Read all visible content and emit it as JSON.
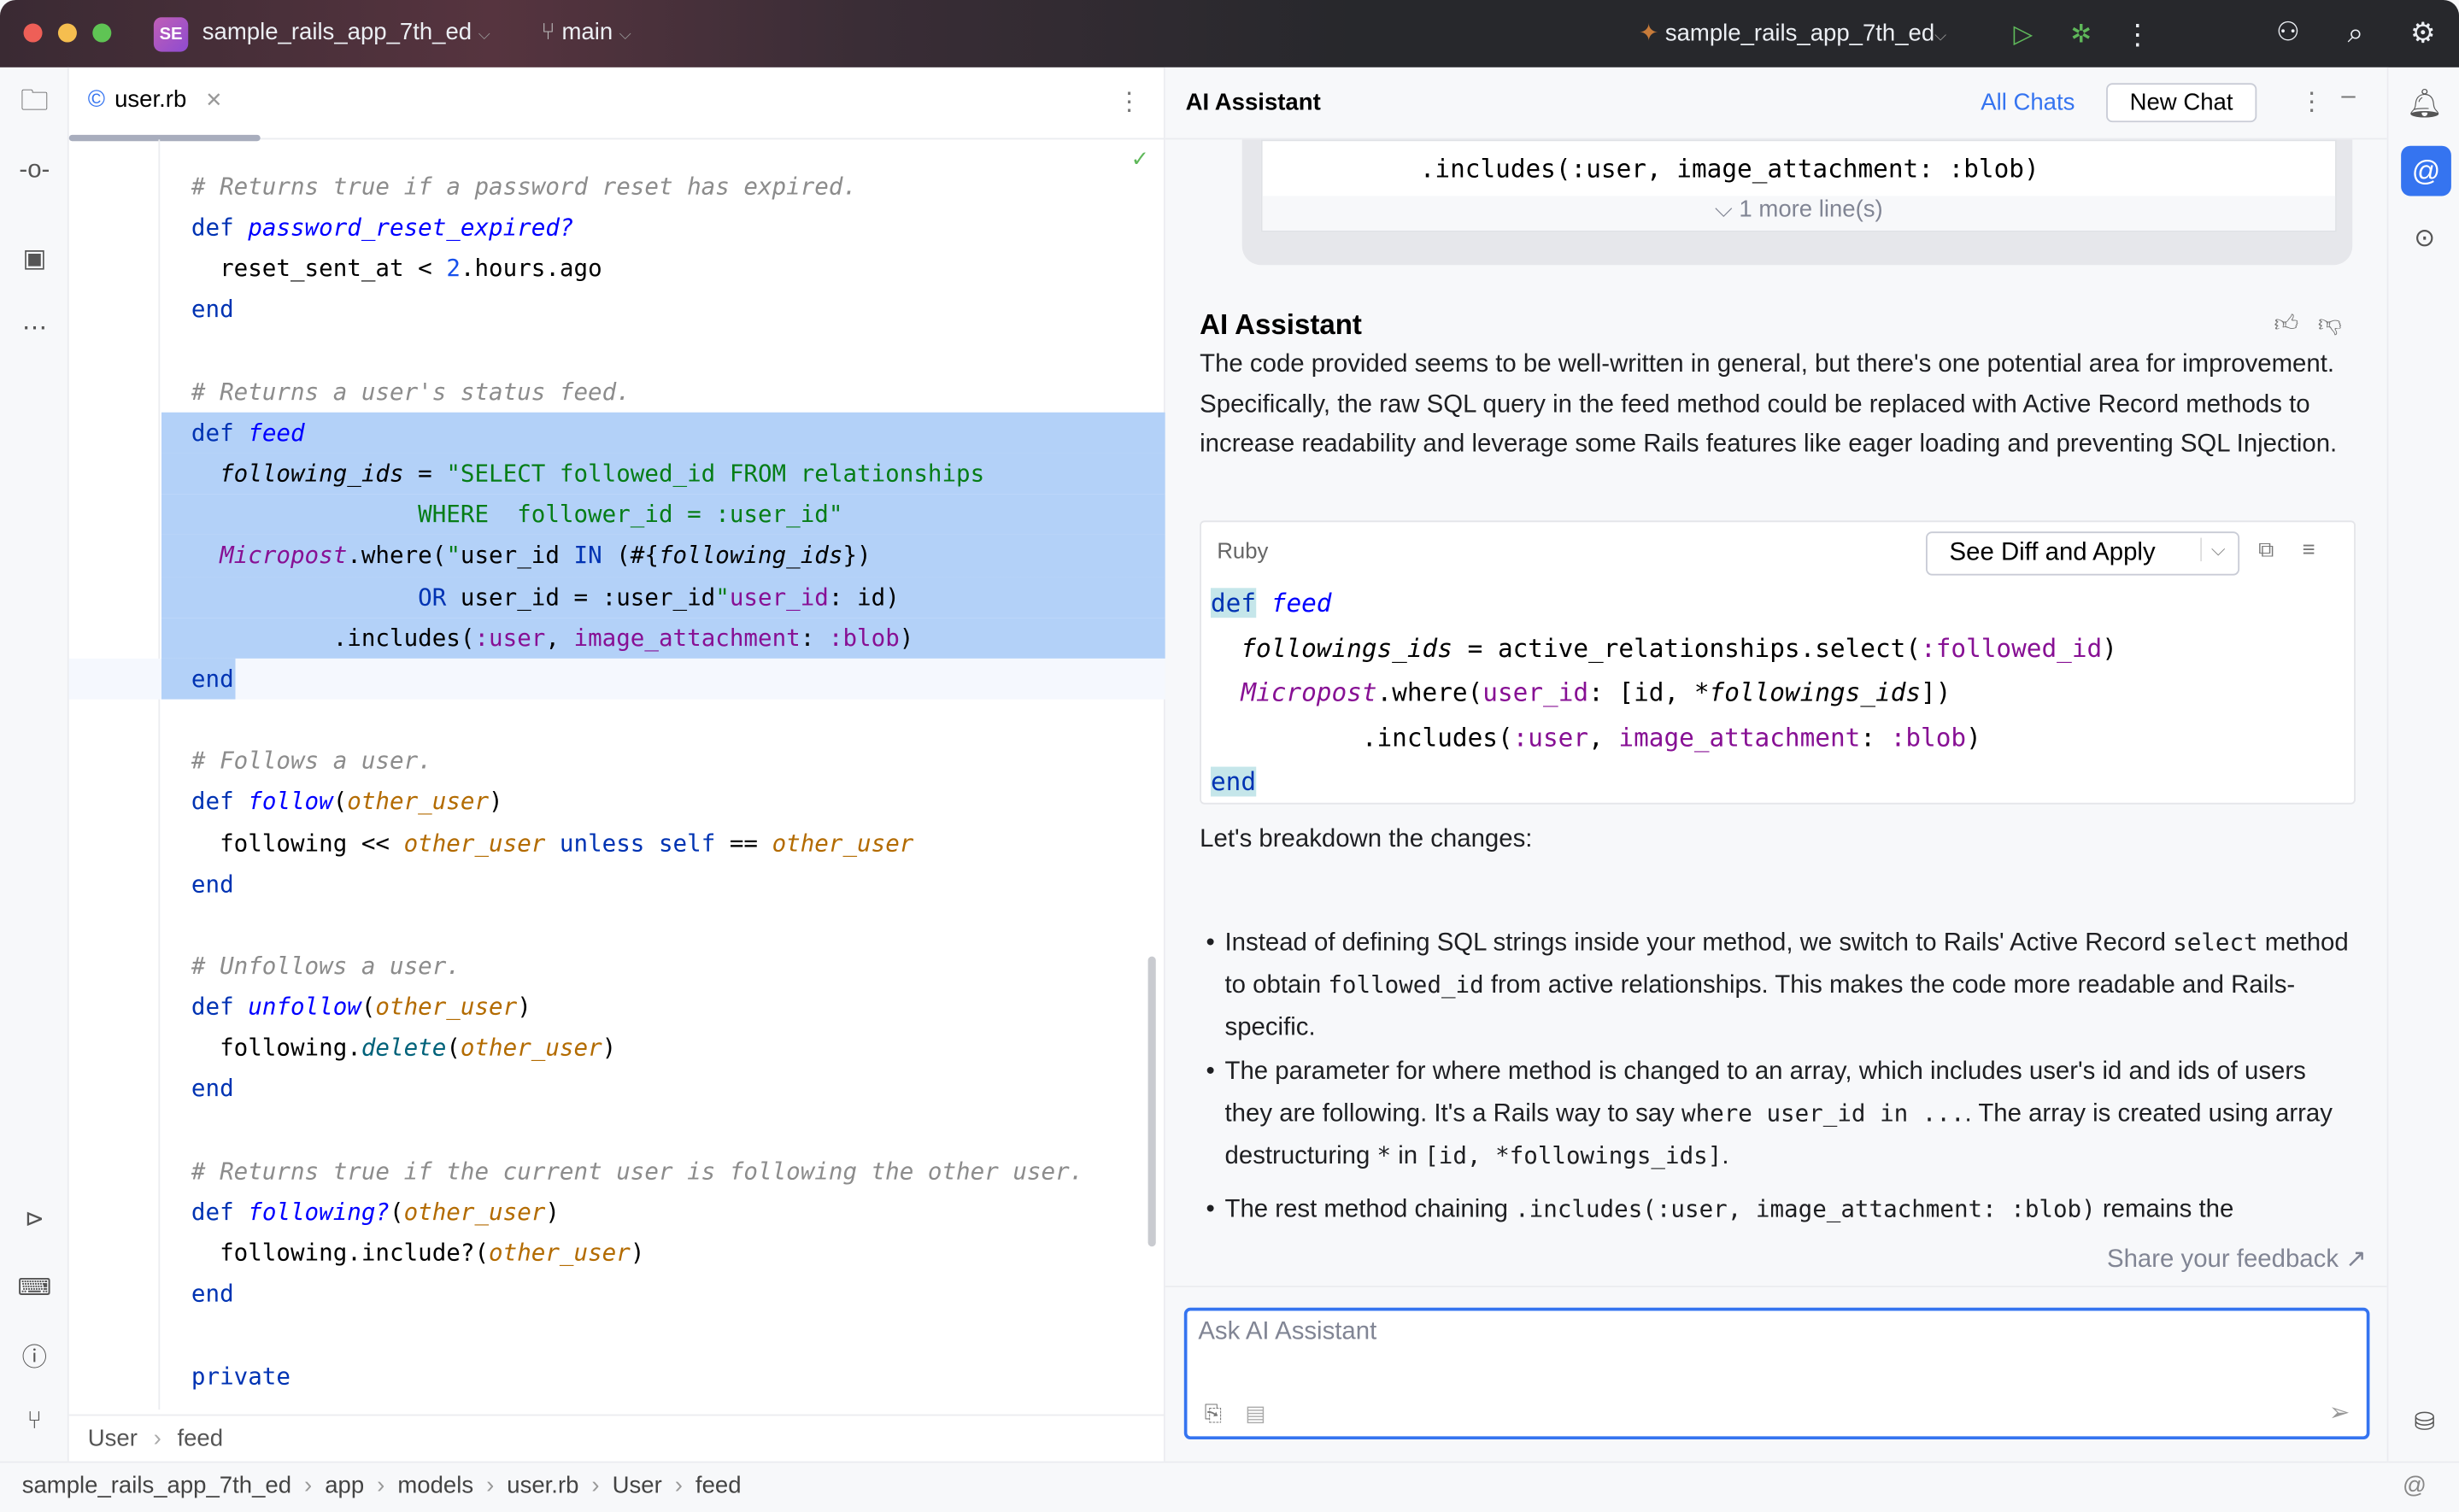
{
  "titlebar": {
    "project_badge": "SE",
    "project": "sample_rails_app_7th_ed",
    "branch": "main",
    "run_config": "sample_rails_app_7th_ed"
  },
  "editor": {
    "tab": "user.rb",
    "breadcrumb": [
      "User",
      "feed"
    ],
    "lines": [
      [
        [
          "c",
          "# Returns true "
        ],
        [
          "c",
          "if"
        ],
        [
          "c",
          " a password reset has expired."
        ]
      ],
      [
        [
          "k",
          "def "
        ],
        [
          "f",
          "password_reset_expired?"
        ]
      ],
      [
        [
          "",
          "  reset_sent_at < "
        ],
        [
          "n",
          "2"
        ],
        [
          "",
          ".hours.ago"
        ]
      ],
      [
        [
          "k",
          "end"
        ]
      ],
      [],
      [
        [
          "c",
          "# Returns a user's status feed."
        ]
      ],
      [
        [
          "k",
          "def "
        ],
        [
          "f",
          "feed"
        ]
      ],
      [
        [
          "",
          "  "
        ],
        [
          "lv",
          "following_ids"
        ],
        [
          "",
          " = "
        ],
        [
          "s",
          "\"SELECT followed_id FROM relationships"
        ]
      ],
      [
        [
          "s",
          "                WHERE  follower_id = :user_id\""
        ]
      ],
      [
        [
          "",
          "  "
        ],
        [
          "cls",
          "Micropost"
        ],
        [
          "",
          ".where("
        ],
        [
          "s",
          "\""
        ],
        [
          "",
          "user_id "
        ],
        [
          "k",
          "IN"
        ],
        [
          "",
          " (#{"
        ],
        [
          "lv",
          "following_ids"
        ],
        [
          "",
          "})"
        ]
      ],
      [
        [
          "",
          "                "
        ],
        [
          "k",
          "OR"
        ],
        [
          "",
          " user_id = :user_id"
        ],
        [
          "s",
          "\""
        ],
        [
          ", "
        ],
        [
          "sym",
          "user_id"
        ],
        [
          "",
          ": id)"
        ]
      ],
      [
        [
          "",
          "          .includes("
        ],
        [
          "sym",
          ":user"
        ],
        [
          "",
          ", "
        ],
        [
          "sym",
          "image_attachment"
        ],
        [
          "",
          ": "
        ],
        [
          "sym",
          ":blob"
        ],
        [
          "",
          ")"
        ]
      ],
      [
        [
          "k",
          "end"
        ]
      ],
      [],
      [
        [
          "c",
          "# Follows a user."
        ]
      ],
      [
        [
          "k",
          "def "
        ],
        [
          "f",
          "follow"
        ],
        [
          "",
          "("
        ],
        [
          "p",
          "other_user"
        ],
        [
          "",
          ")"
        ]
      ],
      [
        [
          "",
          "  following << "
        ],
        [
          "p",
          "other_user"
        ],
        [
          "k",
          " unless self"
        ],
        [
          "",
          " == "
        ],
        [
          "p",
          "other_user"
        ]
      ],
      [
        [
          "k",
          "end"
        ]
      ],
      [],
      [
        [
          "c",
          "# Unfollows a user."
        ]
      ],
      [
        [
          "k",
          "def "
        ],
        [
          "f",
          "unfollow"
        ],
        [
          "",
          "("
        ],
        [
          "p",
          "other_user"
        ],
        [
          "",
          ")"
        ]
      ],
      [
        [
          "",
          "  following."
        ],
        [
          "m",
          "delete"
        ],
        [
          "",
          "("
        ],
        [
          "p",
          "other_user"
        ],
        [
          "",
          ")"
        ]
      ],
      [
        [
          "k",
          "end"
        ]
      ],
      [],
      [
        [
          "c",
          "# Returns true "
        ],
        [
          "c",
          "if"
        ],
        [
          "c",
          " the current user is following the other user."
        ]
      ],
      [
        [
          "k",
          "def "
        ],
        [
          "f",
          "following?"
        ],
        [
          "",
          "("
        ],
        [
          "p",
          "other_user"
        ],
        [
          "",
          ")"
        ]
      ],
      [
        [
          "",
          "  following.include?("
        ],
        [
          "p",
          "other_user"
        ],
        [
          "",
          ")"
        ]
      ],
      [
        [
          "k",
          "end"
        ]
      ],
      [],
      [
        [
          "k",
          "private"
        ]
      ]
    ]
  },
  "chat": {
    "title": "AI Assistant",
    "all_chats": "All Chats",
    "new_chat": "New Chat",
    "prev_snippet_line": "          .includes(:user, image_attachment: :blob)",
    "more_lines": "1 more line(s)",
    "author": "AI Assistant",
    "intro": "The code provided seems to be well-written in general, but there's one potential area for improvement. Specifically, the raw SQL query in the feed method could be replaced with Active Record methods to increase readability and leverage some Rails features like eager loading and preventing SQL Injection.",
    "code_lang": "Ruby",
    "apply_button": "See Diff and Apply",
    "code_lines": [
      [
        [
          "k",
          "def"
        ],
        [
          "",
          " "
        ],
        [
          "f",
          "feed"
        ]
      ],
      [
        [
          "",
          "  "
        ],
        [
          "lv",
          "followings_ids"
        ],
        [
          "",
          " = active_relationships.select("
        ],
        [
          "sym",
          ":followed_id"
        ],
        [
          "",
          ")"
        ]
      ],
      [
        [
          "",
          "  "
        ],
        [
          "cls",
          "Micropost"
        ],
        [
          "",
          ".where("
        ],
        [
          "sym",
          "user_id"
        ],
        [
          "",
          ": [id, *"
        ],
        [
          "lv",
          "followings_ids"
        ],
        [
          "",
          "])"
        ]
      ],
      [
        [
          "",
          "          .includes("
        ],
        [
          "sym",
          ":user"
        ],
        [
          "",
          ", "
        ],
        [
          "sym",
          "image_attachment"
        ],
        [
          "",
          ": "
        ],
        [
          "sym",
          ":blob"
        ],
        [
          "",
          ")"
        ]
      ],
      [
        [
          "k",
          "end"
        ]
      ]
    ],
    "breakdown": "Let's breakdown the changes:",
    "bullets": [
      [
        [
          "t",
          "Instead of defining SQL strings inside your method, we switch to Rails' Active Record "
        ],
        [
          "m",
          "select"
        ],
        [
          "t",
          " method to obtain "
        ],
        [
          "m",
          "followed_id"
        ],
        [
          "t",
          " from active relationships. This makes the code more readable and Rails-specific."
        ]
      ],
      [
        [
          "t",
          "The parameter for where method is changed to an array, which includes user's id and ids of users they are following. It's a Rails way to say "
        ],
        [
          "m",
          "where user_id in ..."
        ],
        [
          "t",
          ". The array is created using array destructuring "
        ],
        [
          "m",
          "*"
        ],
        [
          "t",
          " in "
        ],
        [
          "m",
          "[id, *followings_ids]"
        ],
        [
          "t",
          "."
        ]
      ],
      [
        [
          "t",
          "The rest method chaining "
        ],
        [
          "m",
          ".includes(:user, image_attachment: :blob)"
        ],
        [
          "t",
          " remains the"
        ]
      ]
    ],
    "feedback": "Share your feedback ↗",
    "input_placeholder": "Ask AI Assistant"
  },
  "statusbar": {
    "path": [
      "sample_rails_app_7th_ed",
      "app",
      "models",
      "user.rb",
      "User",
      "feed"
    ]
  }
}
